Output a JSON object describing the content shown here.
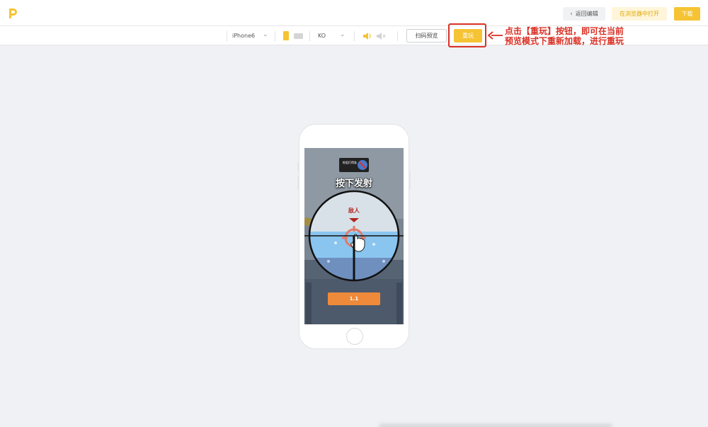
{
  "header": {
    "logo_icon": "p-logo",
    "back_label": "返回编辑",
    "open_browser_label": "在浏览器中打开",
    "download_label": "下载"
  },
  "toolbar": {
    "device_value": "iPhone6",
    "orientation": "portrait",
    "network_value": "KO",
    "sound_on": true,
    "scan_preview_label": "扫码预览",
    "replay_label": "重玩"
  },
  "annotation": {
    "line1": "点击【重玩】按钮，即可在当前",
    "line2": "预览模式下重新加载，进行重玩"
  },
  "game": {
    "badge_text": "枪狙打得准",
    "title": "按下发射",
    "enemy_label": "敌人",
    "level_label": "1.1"
  },
  "colors": {
    "accent": "#f5c333",
    "annotation": "#d93025",
    "level_button": "#ef8a3a"
  }
}
